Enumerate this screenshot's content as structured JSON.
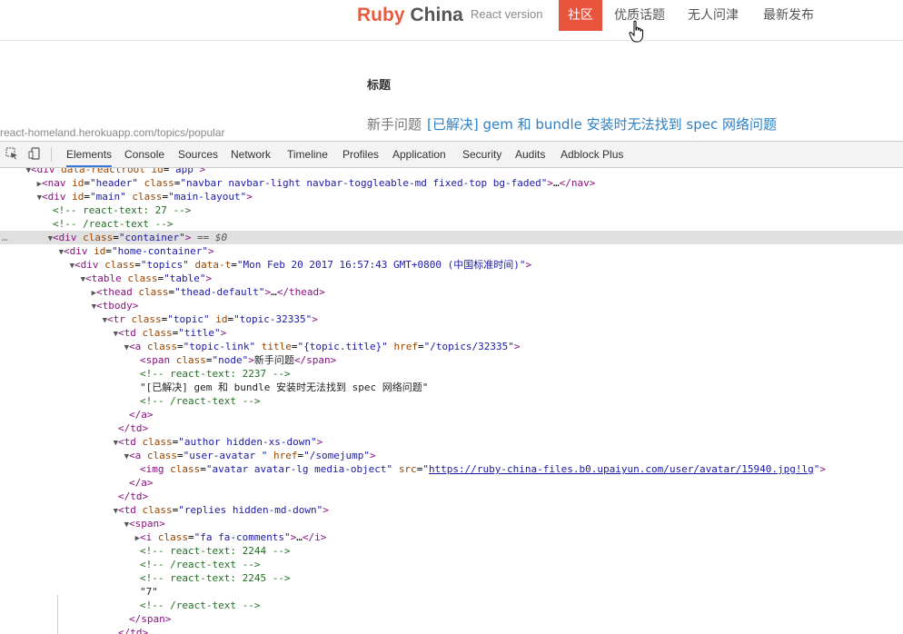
{
  "navbar": {
    "brand": "Ruby",
    "brand2": "China",
    "brand_sub": "React version",
    "links": [
      "社区",
      "优质话题",
      "无人问津",
      "最新发布"
    ],
    "active_index": 0
  },
  "content": {
    "section_title": "标题",
    "topic_node": "新手问题",
    "topic_title": "[已解决] gem 和 bundle 安装时无法找到 spec 网络问题"
  },
  "status_url": "react-homeland.herokuapp.com/topics/popular",
  "devtools": {
    "tabs": [
      "Elements",
      "Console",
      "Sources",
      "Network",
      "Timeline",
      "Profiles",
      "Application",
      "Security",
      "Audits",
      "Adblock Plus"
    ],
    "active_tab": "Elements",
    "dom_lines": [
      {
        "indent": 2,
        "tri": "▼",
        "html": "<span class='tag'>&lt;div</span> <span class='attr'>data-reactroot</span> <span class='attr'>id</span>=<span class='val'>\"app\"</span><span class='tag'>&gt;</span>"
      },
      {
        "indent": 3,
        "tri": "▶",
        "html": "<span class='tag'>&lt;nav</span> <span class='attr'>id</span>=<span class='val'>\"header\"</span> <span class='attr'>class</span>=<span class='val'>\"navbar navbar-light navbar-toggleable-md fixed-top bg-faded\"</span><span class='tag'>&gt;</span>…<span class='tag'>&lt;/nav&gt;</span>"
      },
      {
        "indent": 3,
        "tri": "▼",
        "html": "<span class='tag'>&lt;div</span> <span class='attr'>id</span>=<span class='val'>\"main\"</span> <span class='attr'>class</span>=<span class='val'>\"main-layout\"</span><span class='tag'>&gt;</span>"
      },
      {
        "indent": 4,
        "tri": "",
        "html": "<span class='cmt'>&lt;!-- react-text: 27 --&gt;</span>"
      },
      {
        "indent": 4,
        "tri": "",
        "html": "<span class='cmt'>&lt;!-- /react-text --&gt;</span>"
      },
      {
        "indent": 4,
        "tri": "▼",
        "html": "<span class='tag'>&lt;div</span> <span class='attr'>class</span>=<span class='val'>\"container\"</span><span class='tag'>&gt;</span> <span class='eq'>== $0</span>",
        "sel": true
      },
      {
        "indent": 5,
        "tri": "▼",
        "html": "<span class='tag'>&lt;div</span> <span class='attr'>id</span>=<span class='val'>\"home-container\"</span><span class='tag'>&gt;</span>"
      },
      {
        "indent": 6,
        "tri": "▼",
        "html": "<span class='tag'>&lt;div</span> <span class='attr'>class</span>=<span class='val'>\"topics\"</span> <span class='attr'>data-t</span>=<span class='val'>\"Mon Feb 20 2017 16:57:43 GMT+0800 (中国标准时间)\"</span><span class='tag'>&gt;</span>"
      },
      {
        "indent": 7,
        "tri": "▼",
        "html": "<span class='tag'>&lt;table</span> <span class='attr'>class</span>=<span class='val'>\"table\"</span><span class='tag'>&gt;</span>"
      },
      {
        "indent": 8,
        "tri": "▶",
        "html": "<span class='tag'>&lt;thead</span> <span class='attr'>class</span>=<span class='val'>\"thead-default\"</span><span class='tag'>&gt;</span>…<span class='tag'>&lt;/thead&gt;</span>"
      },
      {
        "indent": 8,
        "tri": "▼",
        "html": "<span class='tag'>&lt;tbody&gt;</span>"
      },
      {
        "indent": 9,
        "tri": "▼",
        "html": "<span class='tag'>&lt;tr</span> <span class='attr'>class</span>=<span class='val'>\"topic\"</span> <span class='attr'>id</span>=<span class='val'>\"topic-32335\"</span><span class='tag'>&gt;</span>"
      },
      {
        "indent": 10,
        "tri": "▼",
        "html": "<span class='tag'>&lt;td</span> <span class='attr'>class</span>=<span class='val'>\"title\"</span><span class='tag'>&gt;</span>"
      },
      {
        "indent": 11,
        "tri": "▼",
        "html": "<span class='tag'>&lt;a</span> <span class='attr'>class</span>=<span class='val'>\"topic-link\"</span> <span class='attr'>title</span>=<span class='val'>\"{topic.title}\"</span> <span class='attr'>href</span>=<span class='val'>\"/topics/32335\"</span><span class='tag'>&gt;</span>"
      },
      {
        "indent": 12,
        "tri": "",
        "html": "<span class='tag'>&lt;span</span> <span class='attr'>class</span>=<span class='val'>\"node\"</span><span class='tag'>&gt;</span><span class='txt'>新手问题</span><span class='tag'>&lt;/span&gt;</span>"
      },
      {
        "indent": 12,
        "tri": "",
        "html": "<span class='cmt'>&lt;!-- react-text: 2237 --&gt;</span>"
      },
      {
        "indent": 12,
        "tri": "",
        "html": "<span class='txt'>\"[已解决] gem 和 bundle 安装时无法找到 spec 网络问题\"</span>"
      },
      {
        "indent": 12,
        "tri": "",
        "html": "<span class='cmt'>&lt;!-- /react-text --&gt;</span>"
      },
      {
        "indent": 11,
        "tri": "",
        "html": "<span class='tag'>&lt;/a&gt;</span>"
      },
      {
        "indent": 10,
        "tri": "",
        "html": "<span class='tag'>&lt;/td&gt;</span>"
      },
      {
        "indent": 10,
        "tri": "▼",
        "html": "<span class='tag'>&lt;td</span> <span class='attr'>class</span>=<span class='val'>\"author hidden-xs-down\"</span><span class='tag'>&gt;</span>"
      },
      {
        "indent": 11,
        "tri": "▼",
        "html": "<span class='tag'>&lt;a</span> <span class='attr'>class</span>=<span class='val'>\"user-avatar \"</span> <span class='attr'>href</span>=<span class='val'>\"/somejump\"</span><span class='tag'>&gt;</span>"
      },
      {
        "indent": 12,
        "tri": "",
        "html": "<span class='tag'>&lt;img</span> <span class='attr'>class</span>=<span class='val'>\"avatar avatar-lg media-object\"</span> <span class='attr'>src</span>=<span class='val'>\"<span class='link'>https://ruby-china-files.b0.upaiyun.com/user/avatar/15940.jpg!lg</span>\"</span><span class='tag'>&gt;</span>"
      },
      {
        "indent": 11,
        "tri": "",
        "html": "<span class='tag'>&lt;/a&gt;</span>"
      },
      {
        "indent": 10,
        "tri": "",
        "html": "<span class='tag'>&lt;/td&gt;</span>"
      },
      {
        "indent": 10,
        "tri": "▼",
        "html": "<span class='tag'>&lt;td</span> <span class='attr'>class</span>=<span class='val'>\"replies hidden-md-down\"</span><span class='tag'>&gt;</span>"
      },
      {
        "indent": 11,
        "tri": "▼",
        "html": "<span class='tag'>&lt;span&gt;</span>"
      },
      {
        "indent": 12,
        "tri": "▶",
        "html": "<span class='tag'>&lt;i</span> <span class='attr'>class</span>=<span class='val'>\"fa fa-comments\"</span><span class='tag'>&gt;</span>…<span class='tag'>&lt;/i&gt;</span>"
      },
      {
        "indent": 12,
        "tri": "",
        "html": "<span class='cmt'>&lt;!-- react-text: 2244 --&gt;</span>"
      },
      {
        "indent": 12,
        "tri": "",
        "html": "<span class='cmt'>&lt;!-- /react-text --&gt;</span>"
      },
      {
        "indent": 12,
        "tri": "",
        "html": "<span class='cmt'>&lt;!-- react-text: 2245 --&gt;</span>"
      },
      {
        "indent": 12,
        "tri": "",
        "html": "<span class='txt'>\"7\"</span>"
      },
      {
        "indent": 12,
        "tri": "",
        "html": "<span class='cmt'>&lt;!-- /react-text --&gt;</span>"
      },
      {
        "indent": 11,
        "tri": "",
        "html": "<span class='tag'>&lt;/span&gt;</span>"
      },
      {
        "indent": 10,
        "tri": "",
        "html": "<span class='tag'>&lt;/td&gt;</span>"
      }
    ]
  }
}
